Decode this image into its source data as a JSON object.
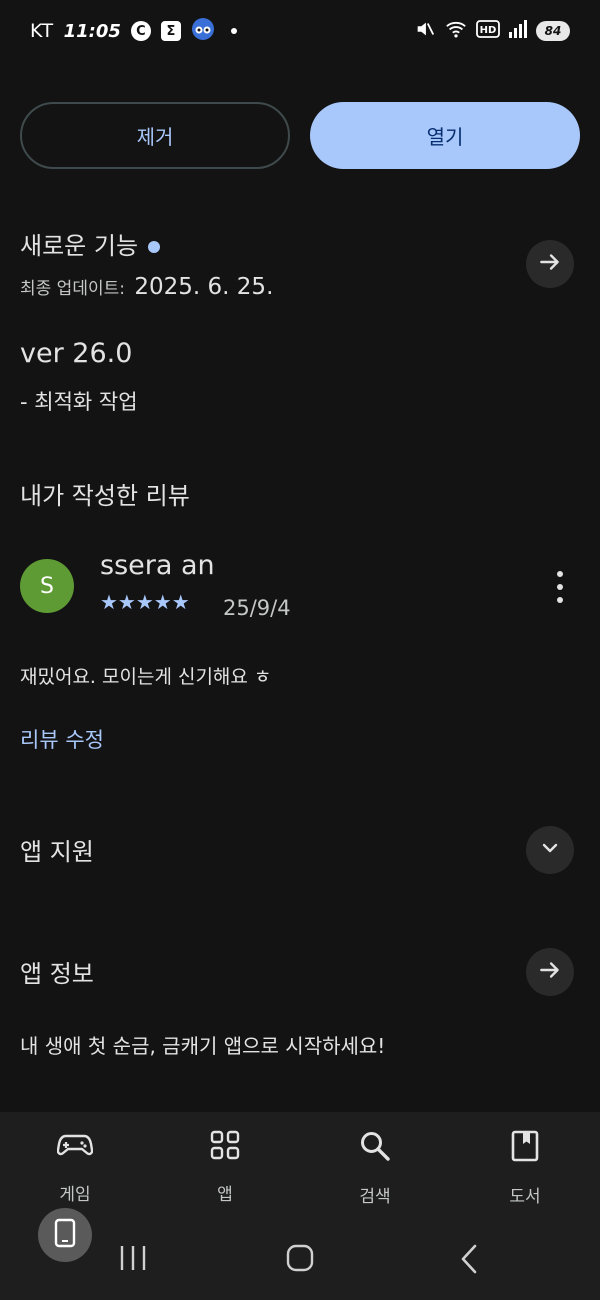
{
  "status_bar": {
    "carrier": "KT",
    "time": "11:05",
    "app_icons": [
      "C",
      "Σ"
    ],
    "battery": "84"
  },
  "buttons": {
    "uninstall": "제거",
    "open": "열기"
  },
  "whats_new": {
    "title": "새로운 기능",
    "updated_label": "최종 업데이트:",
    "updated_date": "2025. 6. 25.",
    "version": "ver 26.0",
    "note": "- 최적화 작업"
  },
  "my_review": {
    "title": "내가 작성한 리뷰",
    "avatar_letter": "S",
    "reviewer": "ssera an",
    "rating": 5,
    "stars": "★★★★★",
    "date": "25/9/4",
    "text": "재밌어요. 모이는게 신기해요 ㅎ",
    "edit": "리뷰 수정"
  },
  "app_support": {
    "title": "앱 지원"
  },
  "app_info": {
    "title": "앱 정보",
    "description": "내 생애 첫 순금, 금캐기 앱으로 시작하세요!"
  },
  "bottom_nav": [
    {
      "label": "게임",
      "icon": "gamepad-icon"
    },
    {
      "label": "앱",
      "icon": "apps-grid-icon"
    },
    {
      "label": "검색",
      "icon": "search-icon"
    },
    {
      "label": "도서",
      "icon": "book-icon"
    }
  ],
  "colors": {
    "background": "#131313",
    "accent": "#a8c7fa",
    "avatar": "#5e9b34"
  }
}
